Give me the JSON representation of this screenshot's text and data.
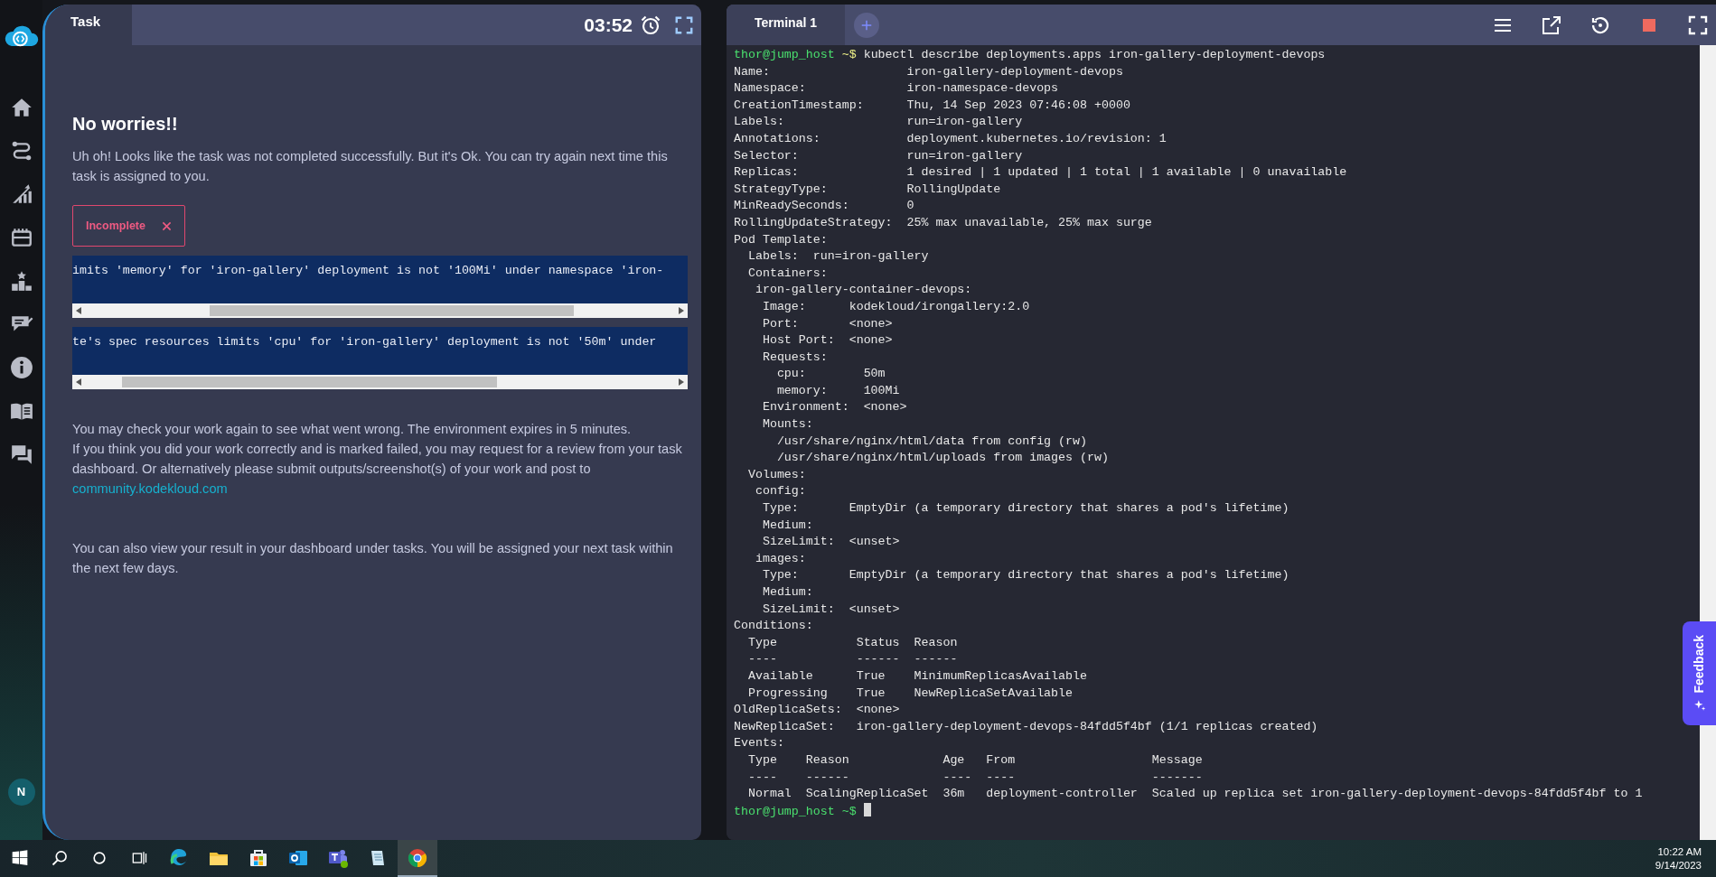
{
  "sidebar": {
    "avatar": "N"
  },
  "task_panel": {
    "tab": "Task",
    "timer": "03:52",
    "heading": "No worries!!",
    "message": "Uh oh! Looks like the task was not completed successfully. But it's Ok. You can try again next time this task is assigned to you.",
    "status_badge": "Incomplete",
    "errors": [
      "imits 'memory' for 'iron-gallery' deployment is not '100Mi' under namespace 'iron-",
      "te's spec resources limits 'cpu' for 'iron-gallery' deployment is not '50m' under"
    ],
    "note_lines": [
      "You may check your work again to see what went wrong. The environment expires in 5 minutes.",
      "If you think you did your work correctly and is marked failed, you may request for a review from your task dashboard. Or alternatively please submit outputs/screenshot(s) of your work and post to"
    ],
    "link": "community.kodekloud.com",
    "footer": "You can also view your result in your dashboard under tasks. You will be assigned your next task within the next few days."
  },
  "terminal": {
    "tabs": [
      {
        "label": "Terminal 1",
        "selected": true
      }
    ],
    "lines": [
      {
        "kind": "prompt",
        "user": "thor@jump_host",
        "path": "~$",
        "command": "kubectl describe deployments.apps iron-gallery-deployment-devops"
      },
      {
        "kind": "output",
        "text": "Name:                   iron-gallery-deployment-devops"
      },
      {
        "kind": "output",
        "text": "Namespace:              iron-namespace-devops"
      },
      {
        "kind": "output",
        "text": "CreationTimestamp:      Thu, 14 Sep 2023 07:46:08 +0000"
      },
      {
        "kind": "output",
        "text": "Labels:                 run=iron-gallery"
      },
      {
        "kind": "output",
        "text": "Annotations:            deployment.kubernetes.io/revision: 1"
      },
      {
        "kind": "output",
        "text": "Selector:               run=iron-gallery"
      },
      {
        "kind": "output",
        "text": "Replicas:               1 desired | 1 updated | 1 total | 1 available | 0 unavailable"
      },
      {
        "kind": "output",
        "text": "StrategyType:           RollingUpdate"
      },
      {
        "kind": "output",
        "text": "MinReadySeconds:        0"
      },
      {
        "kind": "output",
        "text": "RollingUpdateStrategy:  25% max unavailable, 25% max surge"
      },
      {
        "kind": "output",
        "text": "Pod Template:"
      },
      {
        "kind": "output",
        "text": "  Labels:  run=iron-gallery"
      },
      {
        "kind": "output",
        "text": "  Containers:"
      },
      {
        "kind": "output",
        "text": "   iron-gallery-container-devops:"
      },
      {
        "kind": "output",
        "text": "    Image:      kodekloud/irongallery:2.0"
      },
      {
        "kind": "output",
        "text": "    Port:       <none>"
      },
      {
        "kind": "output",
        "text": "    Host Port:  <none>"
      },
      {
        "kind": "output",
        "text": "    Requests:"
      },
      {
        "kind": "output",
        "text": "      cpu:        50m"
      },
      {
        "kind": "output",
        "text": "      memory:     100Mi"
      },
      {
        "kind": "output",
        "text": "    Environment:  <none>"
      },
      {
        "kind": "output",
        "text": "    Mounts:"
      },
      {
        "kind": "output",
        "text": "      /usr/share/nginx/html/data from config (rw)"
      },
      {
        "kind": "output",
        "text": "      /usr/share/nginx/html/uploads from images (rw)"
      },
      {
        "kind": "output",
        "text": "  Volumes:"
      },
      {
        "kind": "output",
        "text": "   config:"
      },
      {
        "kind": "output",
        "text": "    Type:       EmptyDir (a temporary directory that shares a pod's lifetime)"
      },
      {
        "kind": "output",
        "text": "    Medium:"
      },
      {
        "kind": "output",
        "text": "    SizeLimit:  <unset>"
      },
      {
        "kind": "output",
        "text": "   images:"
      },
      {
        "kind": "output",
        "text": "    Type:       EmptyDir (a temporary directory that shares a pod's lifetime)"
      },
      {
        "kind": "output",
        "text": "    Medium:"
      },
      {
        "kind": "output",
        "text": "    SizeLimit:  <unset>"
      },
      {
        "kind": "output",
        "text": "Conditions:"
      },
      {
        "kind": "output",
        "text": "  Type           Status  Reason"
      },
      {
        "kind": "output",
        "text": "  ----           ------  ------"
      },
      {
        "kind": "output",
        "text": "  Available      True    MinimumReplicasAvailable"
      },
      {
        "kind": "output",
        "text": "  Progressing    True    NewReplicaSetAvailable"
      },
      {
        "kind": "output",
        "text": "OldReplicaSets:  <none>"
      },
      {
        "kind": "output",
        "text": "NewReplicaSet:   iron-gallery-deployment-devops-84fdd5f4bf (1/1 replicas created)"
      },
      {
        "kind": "output",
        "text": "Events:"
      },
      {
        "kind": "output",
        "text": "  Type    Reason             Age   From                   Message"
      },
      {
        "kind": "output",
        "text": "  ----    ------             ----  ----                   -------"
      },
      {
        "kind": "output",
        "text": "  Normal  ScalingReplicaSet  36m   deployment-controller  Scaled up replica set iron-gallery-deployment-devops-84fdd5f4bf to 1"
      },
      {
        "kind": "prompt",
        "user": "thor@jump_host",
        "path": "~$",
        "cursor": true
      }
    ]
  },
  "feedback": "Feedback",
  "taskbar": {
    "apps": [
      {
        "kind": "edge",
        "selected": false
      },
      {
        "kind": "explorer",
        "selected": false
      },
      {
        "kind": "store",
        "selected": false
      },
      {
        "kind": "outlook",
        "selected": false
      },
      {
        "kind": "teams",
        "selected": false
      },
      {
        "kind": "notepad",
        "selected": false
      },
      {
        "kind": "chrome",
        "selected": true
      }
    ],
    "time": "10:22 AM",
    "date": "9/14/2023"
  }
}
